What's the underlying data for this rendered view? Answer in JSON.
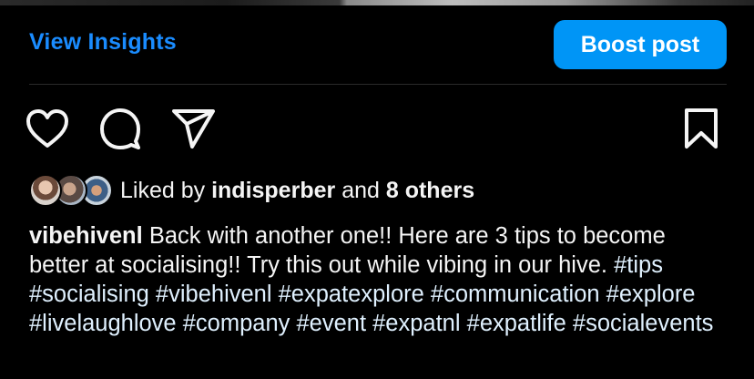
{
  "header": {
    "view_insights": "View Insights",
    "boost_post": "Boost post"
  },
  "actions": {
    "like": "heart-icon",
    "comment": "comment-icon",
    "share": "share-icon",
    "save": "bookmark-icon"
  },
  "likes": {
    "prefix": "Liked by",
    "user": "indisperber",
    "joiner": "and",
    "others": "8 others"
  },
  "caption": {
    "username": "vibehivenl",
    "text": "Back with another one!! Here are 3 tips to become better at socialising!! Try this out while vibing in our hive.",
    "hashtags": [
      "#tips",
      "#socialising",
      "#vibehivenl",
      "#expatexplore",
      "#communication",
      "#explore",
      "#livelaughlove",
      "#company",
      "#event",
      "#expatnl",
      "#expatlife",
      "#socialevents"
    ]
  },
  "colors": {
    "background": "#000000",
    "link_blue": "#1a8cff",
    "button_blue": "#0095f6",
    "hashtag": "#e0f1ff"
  }
}
